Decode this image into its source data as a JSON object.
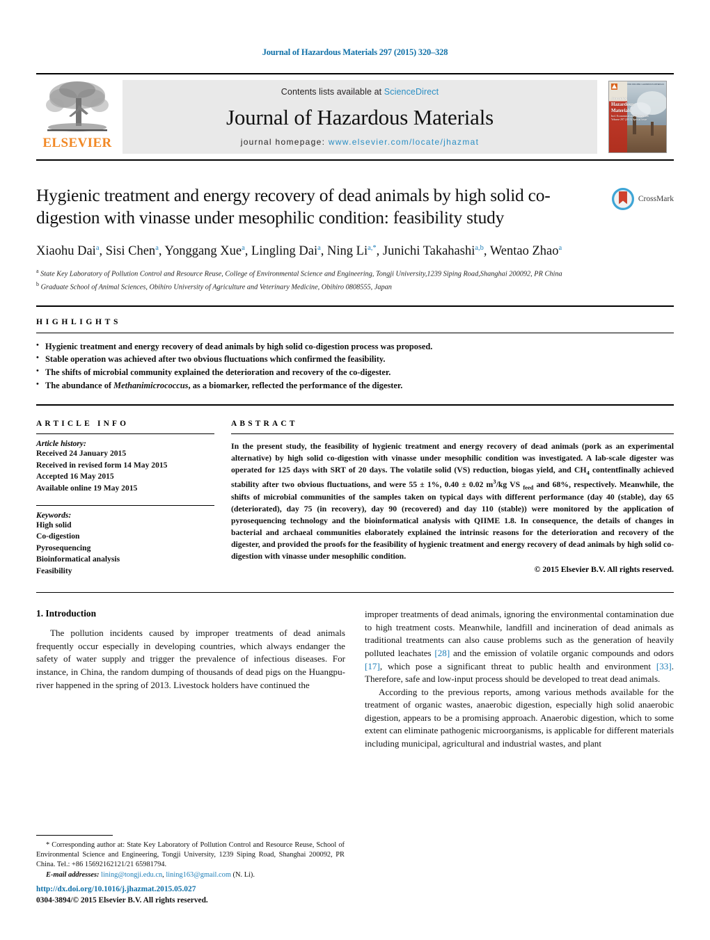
{
  "running_head": "Journal of Hazardous Materials 297 (2015) 320–328",
  "masthead": {
    "publisher_logo_text": "ELSEVIER",
    "contents_prefix": "Contents lists available at ",
    "contents_link": "ScienceDirect",
    "journal_title": "Journal of Hazardous Materials",
    "homepage_prefix": "journal homepage: ",
    "homepage_url": "www.elsevier.com/locate/jhazmat",
    "cover": {
      "line1": "Journal of",
      "line2": "Hazardous",
      "line3": "Materials",
      "sub1": "Incl. Economical and Management",
      "sub2": "Volume 297 (2015) Special Issue",
      "corner_note": "ISSN 0304-3894 / HAZARDOUS MATERIALS"
    }
  },
  "article": {
    "title": "Hygienic treatment and energy recovery of dead animals by high solid co-digestion with vinasse under mesophilic condition: feasibility study",
    "crossmark_label": "CrossMark",
    "authors": [
      {
        "name": "Xiaohu Dai",
        "marks": "a"
      },
      {
        "name": "Sisi Chen",
        "marks": "a"
      },
      {
        "name": "Yonggang Xue",
        "marks": "a"
      },
      {
        "name": "Lingling Dai",
        "marks": "a"
      },
      {
        "name": "Ning Li",
        "marks": "a,*"
      },
      {
        "name": "Junichi Takahashi",
        "marks": "a,b"
      },
      {
        "name": "Wentao Zhao",
        "marks": "a"
      }
    ],
    "affiliations": [
      {
        "mark": "a",
        "text": "State Key Laboratory of Pollution Control and Resource Reuse, College of Environmental Science and Engineering, Tongji University,1239 Siping Road,Shanghai 200092, PR China"
      },
      {
        "mark": "b",
        "text": "Graduate School of Animal Sciences, Obihiro University of Agriculture and Veterinary Medicine, Obihiro 0808555, Japan"
      }
    ]
  },
  "highlights": {
    "heading": "HIGHLIGHTS",
    "items": [
      "Hygienic treatment and energy recovery of dead animals by high solid co-digestion process was proposed.",
      "Stable operation was achieved after two obvious fluctuations which confirmed the feasibility.",
      "The shifts of microbial community explained the deterioration and recovery of the co-digester.",
      "The abundance of Methanimicrococcus, as a biomarker, reflected the performance of the digester."
    ],
    "italic_term": "Methanimicrococcus"
  },
  "article_info": {
    "heading": "ARTICLE INFO",
    "history_label": "Article history:",
    "history": [
      "Received 24 January 2015",
      "Received in revised form 14 May 2015",
      "Accepted 16 May 2015",
      "Available online 19 May 2015"
    ],
    "keywords_label": "Keywords:",
    "keywords": [
      "High solid",
      "Co-digestion",
      "Pyrosequencing",
      "Bioinformatical analysis",
      "Feasibility"
    ]
  },
  "abstract": {
    "heading": "ABSTRACT",
    "text": "In the present study, the feasibility of hygienic treatment and energy recovery of dead animals (pork as an experimental alternative) by high solid co-digestion with vinasse under mesophilic condition was investigated. A lab-scale digester was operated for 125 days with SRT of 20 days. The volatile solid (VS) reduction, biogas yield, and CH4 contentfinally achieved stability after two obvious fluctuations, and were 55 ± 1%, 0.40 ± 0.02 m3/kg VS feed and 68%, respectively. Meanwhile, the shifts of microbial communities of the samples taken on typical days with different performance (day 40 (stable), day 65 (deteriorated), day 75 (in recovery), day 90 (recovered) and day 110 (stable)) were monitored by the application of pyrosequencing technology and the bioinformatical analysis with QIIME 1.8. In consequence, the details of changes in bacterial and archaeal communities elaborately explained the intrinsic reasons for the deterioration and recovery of the digester, and provided the proofs for the feasibility of hygienic treatment and energy recovery of dead animals by high solid co-digestion with vinasse under mesophilic condition.",
    "copyright": "© 2015 Elsevier B.V. All rights reserved."
  },
  "body": {
    "section_number_title": "1.  Introduction",
    "left_paragraph_1": "The pollution incidents caused by improper treatments of dead animals frequently occur especially in developing countries, which always endanger the safety of water supply and trigger the prevalence of infectious diseases. For instance, in China, the random dumping of thousands of dead pigs on the Huangpu-river happened in the spring of 2013. Livestock holders have continued the",
    "right_paragraph_1_a": "improper treatments of dead animals, ignoring the environmental contamination due to high treatment costs. Meanwhile, landfill and incineration of dead animals as traditional treatments can also cause problems such as the generation of heavily polluted leachates ",
    "ref_28": "[28]",
    "right_paragraph_1_b": " and the emission of volatile organic compounds and odors ",
    "ref_17": "[17]",
    "right_paragraph_1_c": ", which pose a significant threat to public health and environment ",
    "ref_33": "[33]",
    "right_paragraph_1_d": ". Therefore, safe and low-input process should be developed to treat dead animals.",
    "right_paragraph_2": "According to the previous reports, among various methods available for the treatment of organic wastes, anaerobic digestion, especially high solid anaerobic digestion, appears to be a promising approach. Anaerobic digestion, which to some extent can eliminate pathogenic microorganisms, is applicable for different materials including municipal, agricultural and industrial wastes, and plant"
  },
  "footnote": {
    "star": "*",
    "corr_text": " Corresponding author at: State Key Laboratory of Pollution Control and Resource Reuse, School of Environmental Science and Engineering, Tongji University, 1239 Siping Road, Shanghai 200092, PR China. Tel.: +86 15692162121/21 65981794.",
    "email_label": "E-mail addresses:",
    "email_1": "lining@tongji.edu.cn",
    "email_2": "lining163@gmail.com",
    "email_suffix": " (N. Li).",
    "doi": "http://dx.doi.org/10.1016/j.jhazmat.2015.05.027",
    "issn": "0304-3894/© 2015 Elsevier B.V. All rights reserved."
  },
  "colors": {
    "link_blue": "#1f7fb8",
    "header_blue": "#1171a8",
    "sciencedirect_blue": "#2a8ec4",
    "elsevier_orange": "#f18825",
    "masthead_grey": "#e9e9e9"
  }
}
